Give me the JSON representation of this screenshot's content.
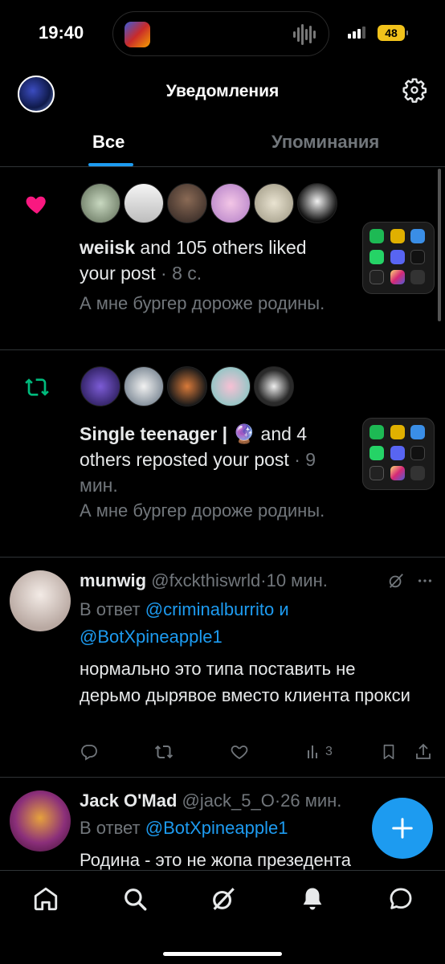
{
  "status_bar": {
    "time": "19:40",
    "battery": "48"
  },
  "header": {
    "title": "Уведомления"
  },
  "tabs": {
    "all": "Все",
    "mentions": "Упоминания"
  },
  "notifications": [
    {
      "type": "like",
      "actor": "weiisk",
      "action_text": " and 105 others liked your post",
      "time": "8 с.",
      "preview": "А мне бургер дороже родины."
    },
    {
      "type": "repost",
      "actor": "Single teenager | 🔮",
      "action_text": " and 4 others reposted your post",
      "time": "9 мин.",
      "preview": "А мне бургер дороже родины."
    }
  ],
  "tweets": [
    {
      "name": "munwig",
      "handle": "@fxckthiswrld",
      "time": "10 мин.",
      "reply_prefix": "В ответ ",
      "mention_1": "@criminalburrito",
      "reply_joiner": " и",
      "mention_2": "@BotXpineapple1",
      "text": "нормально это типа поставить не дерьмо дырявое вместо клиента прокси",
      "views": "3"
    },
    {
      "name": "Jack O'Mad",
      "handle": "@jack_5_O",
      "time": "26 мин.",
      "reply_prefix": "В ответ ",
      "mention_1": "@BotXpineapple1",
      "text": "Родина - это не жопа презедента"
    }
  ],
  "colors": {
    "background": "#000000",
    "accent": "#1d9bf0",
    "like": "#f91880",
    "repost": "#00ba7c",
    "muted_text": "#71767b",
    "battery": "#f1c21b"
  },
  "icons": {
    "settings": "gear-icon",
    "like": "heart-icon",
    "repost": "repost-icon",
    "compose": "plus-icon",
    "nav": [
      "home-icon",
      "search-icon",
      "grok-icon",
      "bell-icon",
      "messages-icon"
    ]
  }
}
